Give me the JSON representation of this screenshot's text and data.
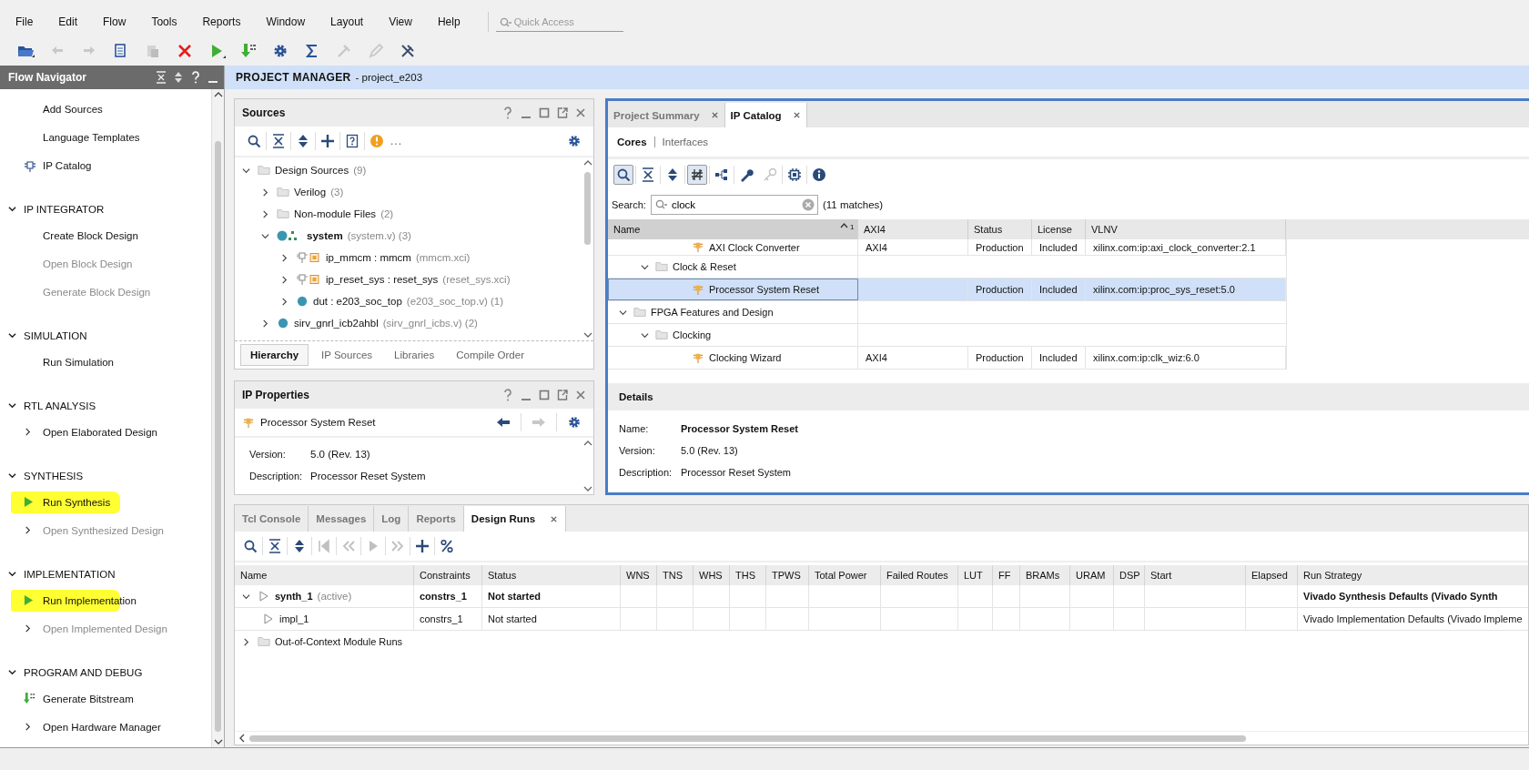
{
  "menu": [
    {
      "label": "File"
    },
    {
      "label": "Edit"
    },
    {
      "label": "Flow"
    },
    {
      "label": "Tools"
    },
    {
      "label": "Reports"
    },
    {
      "label": "Window"
    },
    {
      "label": "Layout"
    },
    {
      "label": "View"
    },
    {
      "label": "Help"
    }
  ],
  "quick_access": {
    "placeholder": "Quick Access"
  },
  "flow_navigator": {
    "title": "Flow Navigator",
    "sections": [
      {
        "items": [
          {
            "label": "Add Sources",
            "kind": "plain",
            "disabled": false,
            "highlighted": false
          },
          {
            "label": "Language Templates",
            "kind": "plain",
            "disabled": false,
            "highlighted": false
          },
          {
            "label": "IP Catalog",
            "kind": "ip",
            "disabled": false,
            "highlighted": false
          }
        ]
      },
      {
        "title": "IP INTEGRATOR",
        "expanded": true,
        "items": [
          {
            "label": "Create Block Design",
            "kind": "plain",
            "disabled": false,
            "highlighted": false
          },
          {
            "label": "Open Block Design",
            "kind": "plain",
            "disabled": true,
            "highlighted": false
          },
          {
            "label": "Generate Block Design",
            "kind": "plain",
            "disabled": true,
            "highlighted": false
          }
        ]
      },
      {
        "title": "SIMULATION",
        "expanded": true,
        "items": [
          {
            "label": "Run Simulation",
            "kind": "plain",
            "disabled": false,
            "highlighted": false
          }
        ]
      },
      {
        "title": "RTL ANALYSIS",
        "expanded": true,
        "items": [
          {
            "label": "Open Elaborated Design",
            "kind": "expander",
            "disabled": false,
            "highlighted": false
          }
        ]
      },
      {
        "title": "SYNTHESIS",
        "expanded": true,
        "items": [
          {
            "label": "Run Synthesis",
            "kind": "run",
            "disabled": false,
            "highlighted": true
          },
          {
            "label": "Open Synthesized Design",
            "kind": "expander",
            "disabled": true,
            "highlighted": false
          }
        ]
      },
      {
        "title": "IMPLEMENTATION",
        "expanded": true,
        "items": [
          {
            "label": "Run Implementation",
            "kind": "run",
            "disabled": false,
            "highlighted": true
          },
          {
            "label": "Open Implemented Design",
            "kind": "expander",
            "disabled": true,
            "highlighted": false
          }
        ]
      },
      {
        "title": "PROGRAM AND DEBUG",
        "expanded": true,
        "items": [
          {
            "label": "Generate Bitstream",
            "kind": "bitstream",
            "disabled": false,
            "highlighted": false
          },
          {
            "label": "Open Hardware Manager",
            "kind": "expander",
            "disabled": false,
            "highlighted": false
          }
        ]
      }
    ]
  },
  "project_manager": {
    "title": "PROJECT MANAGER",
    "subtitle": "- project_e203"
  },
  "sources": {
    "title": "Sources",
    "toolbar_more": "...",
    "tree": [
      {
        "name": "Design Sources",
        "meta": "(9)",
        "kind": "folder",
        "bold": false,
        "expanded": true,
        "children": [
          {
            "name": "Verilog",
            "meta": "(3)",
            "kind": "folder",
            "bold": false,
            "expanded": false
          },
          {
            "name": "Non-module Files",
            "meta": "(2)",
            "kind": "folder",
            "bold": false,
            "expanded": false
          },
          {
            "name": "system",
            "meta": "(system.v) (3)",
            "kind": "top-module",
            "bold": true,
            "expanded": true,
            "children": [
              {
                "name": "ip_mmcm : mmcm",
                "meta": "(mmcm.xci)",
                "kind": "ip",
                "bold": false,
                "expanded": false
              },
              {
                "name": "ip_reset_sys : reset_sys",
                "meta": "(reset_sys.xci)",
                "kind": "ip",
                "bold": false,
                "expanded": false
              },
              {
                "name": "dut : e203_soc_top",
                "meta": "(e203_soc_top.v) (1)",
                "kind": "module",
                "bold": false,
                "expanded": false
              }
            ]
          },
          {
            "name": "sirv_gnrl_icb2ahbl",
            "meta": "(sirv_gnrl_icbs.v) (2)",
            "kind": "module",
            "bold": false,
            "expanded": false
          }
        ]
      }
    ],
    "tabs": [
      {
        "label": "Hierarchy",
        "selected": true
      },
      {
        "label": "IP Sources",
        "selected": false
      },
      {
        "label": "Libraries",
        "selected": false
      },
      {
        "label": "Compile Order",
        "selected": false
      }
    ]
  },
  "ip_properties": {
    "title": "IP Properties",
    "name": "Processor System Reset",
    "fields": [
      {
        "label": "Version:",
        "value": "5.0 (Rev. 13)"
      },
      {
        "label": "Description:",
        "value": "Processor Reset System"
      }
    ]
  },
  "ip_catalog": {
    "tabs": [
      {
        "label": "Project Summary",
        "selected": false
      },
      {
        "label": "IP Catalog",
        "selected": true
      }
    ],
    "subtabs": [
      {
        "label": "Cores",
        "selected": true
      },
      {
        "label": "Interfaces",
        "selected": false
      }
    ],
    "search": {
      "label": "Search:",
      "value": "clock",
      "matches": "(11 matches)"
    },
    "table": {
      "columns": [
        "Name",
        "AXI4",
        "Status",
        "License",
        "VLNV"
      ],
      "sort_rank": "1",
      "rows": [
        {
          "kind": "hidden",
          "children": [
            {
              "kind": "hidden",
              "children": [
                {
                  "kind": "ip",
                  "selected": false,
                  "name": "AXI Clock Converter",
                  "axi4": "AXI4",
                  "status": "Production",
                  "license": "Included",
                  "vlnv": "xilinx.com:ip:axi_clock_converter:2.1"
                }
              ]
            },
            {
              "kind": "folder",
              "name": "Clock & Reset",
              "expanded": true,
              "selected": false,
              "children": [
                {
                  "kind": "ip",
                  "selected": true,
                  "name": "Processor System Reset",
                  "status": "Production",
                  "license": "Included",
                  "vlnv": "xilinx.com:ip:proc_sys_reset:5.0"
                }
              ]
            }
          ]
        },
        {
          "kind": "folder",
          "name": "FPGA Features and Design",
          "expanded": true,
          "selected": false,
          "children": [
            {
              "kind": "folder",
              "name": "Clocking",
              "expanded": true,
              "selected": false,
              "children": [
                {
                  "kind": "ip",
                  "selected": false,
                  "name": "Clocking Wizard",
                  "axi4": "AXI4",
                  "status": "Production",
                  "license": "Included",
                  "vlnv": "xilinx.com:ip:clk_wiz:6.0"
                }
              ]
            }
          ]
        }
      ]
    },
    "details": {
      "title": "Details",
      "fields": [
        {
          "label": "Name:",
          "value": "Processor System Reset",
          "bold": true
        },
        {
          "label": "Version:",
          "value": "5.0 (Rev. 13)",
          "bold": false
        },
        {
          "label": "Description:",
          "value": "Processor Reset System",
          "bold": false
        }
      ]
    }
  },
  "bottom_panel": {
    "tabs": [
      {
        "label": "Tcl Console",
        "selected": false
      },
      {
        "label": "Messages",
        "selected": false
      },
      {
        "label": "Log",
        "selected": false
      },
      {
        "label": "Reports",
        "selected": false
      },
      {
        "label": "Design Runs",
        "selected": true
      }
    ],
    "columns": [
      "Name",
      "Constraints",
      "Status",
      "WNS",
      "TNS",
      "WHS",
      "THS",
      "TPWS",
      "Total Power",
      "Failed Routes",
      "LUT",
      "FF",
      "BRAMs",
      "URAM",
      "DSP",
      "Start",
      "Elapsed",
      "Run Strategy"
    ],
    "rows": [
      {
        "kind": "run",
        "name": "synth_1",
        "meta": "(active)",
        "bold": true,
        "expanded": true,
        "constraints": "constrs_1",
        "status": "Not started",
        "strategy": "Vivado Synthesis Defaults (Vivado Synth",
        "children": [
          {
            "kind": "run",
            "name": "impl_1",
            "bold": false,
            "constraints": "constrs_1",
            "status": "Not started",
            "strategy": "Vivado Implementation Defaults (Vivado Impleme"
          }
        ]
      },
      {
        "kind": "folder",
        "name": "Out-of-Context Module Runs",
        "bold": false,
        "expanded": false
      }
    ]
  }
}
